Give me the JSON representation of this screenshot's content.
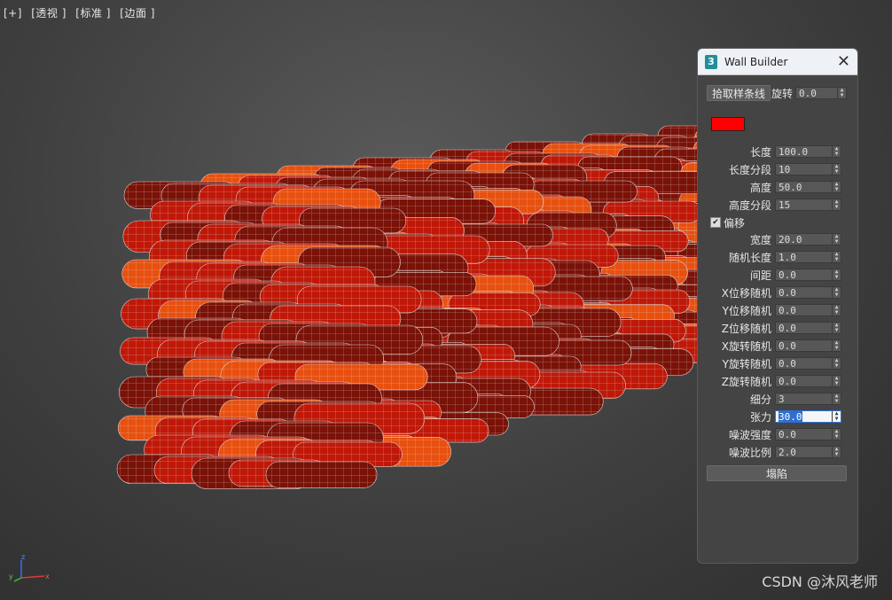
{
  "viewport": {
    "labels": [
      "[+]",
      "[透视 ]",
      "[标准 ]",
      "[边面 ]"
    ],
    "axis": {
      "x": "x",
      "y": "y",
      "z": "z"
    }
  },
  "watermark": "CSDN @沐风老师",
  "dialog": {
    "app_icon": "3",
    "title": "Wall Builder",
    "pick_button": "拾取样条线",
    "rotation_label": "旋转",
    "rotation_value": "0.0",
    "color_swatch": "#ff0000",
    "offset_checkbox": {
      "label": "偏移",
      "checked": true,
      "mark": "✔"
    },
    "params_a": [
      {
        "label": "长度",
        "value": "100.0"
      },
      {
        "label": "长度分段",
        "value": "10"
      },
      {
        "label": "高度",
        "value": "50.0"
      },
      {
        "label": "高度分段",
        "value": "15"
      }
    ],
    "params_b": [
      {
        "label": "宽度",
        "value": "20.0"
      },
      {
        "label": "随机长度",
        "value": "1.0"
      },
      {
        "label": "间距",
        "value": "0.0"
      },
      {
        "label": "X位移随机",
        "value": "0.0"
      },
      {
        "label": "Y位移随机",
        "value": "0.0"
      },
      {
        "label": "Z位移随机",
        "value": "0.0"
      },
      {
        "label": "X旋转随机",
        "value": "0.0"
      },
      {
        "label": "Y旋转随机",
        "value": "0.0"
      },
      {
        "label": "Z旋转随机",
        "value": "0.0"
      },
      {
        "label": "细分",
        "value": "3"
      },
      {
        "label": "张力",
        "value": "30.0"
      },
      {
        "label": "噪波强度",
        "value": "0.0"
      },
      {
        "label": "噪波比例",
        "value": "2.0"
      }
    ],
    "collapse_button": "塌陷"
  },
  "colors": {
    "brick_dark": "#7a1208",
    "brick_red": "#c01808",
    "brick_orange": "#e85010",
    "wire": "#d9d0cc"
  }
}
